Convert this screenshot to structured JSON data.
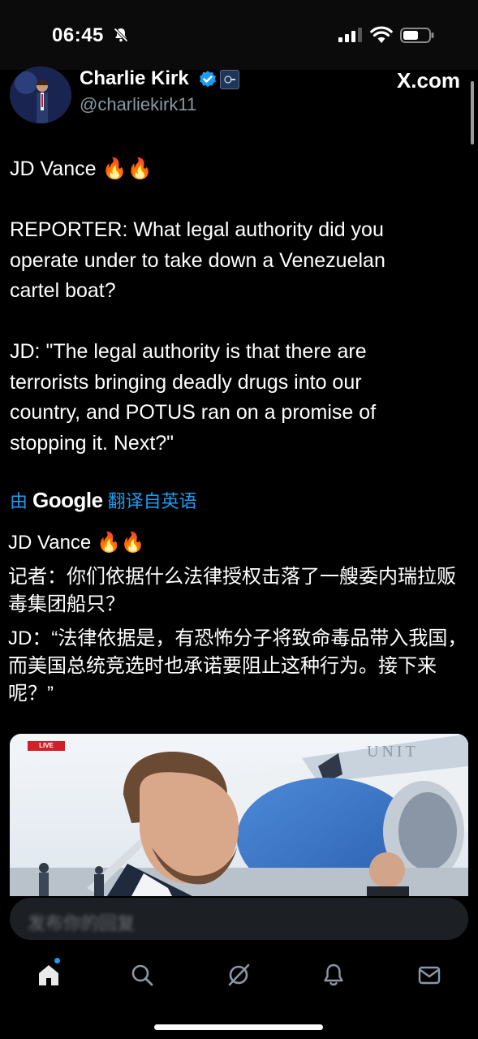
{
  "status_bar": {
    "time": "06:45"
  },
  "post": {
    "author_name": "Charlie Kirk",
    "author_handle": "@charliekirk11",
    "source": "X.com",
    "text_lines": [
      "JD Vance 🔥🔥",
      "",
      "REPORTER: What legal authority did you",
      "operate under to take down a Venezuelan",
      "cartel boat?",
      "",
      "JD: \"The legal authority is that there are",
      "terrorists bringing deadly drugs into our",
      "country, and POTUS ran on a promise of",
      "stopping it. Next?\""
    ],
    "translate": {
      "prefix": "由",
      "brand": "Google",
      "suffix": "翻译自英语"
    },
    "translated_paragraphs": [
      "JD Vance 🔥🔥",
      "记者：你们依据什么法律授权击落了一艘委内瑞拉贩毒集团船只？",
      "JD：“法律依据是，有恐怖分子将致命毒品带入我国，而美国总统竞选时也承诺要阻止这种行为。接下来呢？”"
    ],
    "video": {
      "badge": "LIVE"
    }
  },
  "composer": {
    "placeholder": "发布你的回复"
  },
  "tabs": [
    {
      "name": "home",
      "icon": "home-icon"
    },
    {
      "name": "search",
      "icon": "search-icon"
    },
    {
      "name": "grok",
      "icon": "grok-icon"
    },
    {
      "name": "notifications",
      "icon": "bell-icon"
    },
    {
      "name": "messages",
      "icon": "mail-icon"
    }
  ],
  "colors": {
    "accent": "#1d9bf0",
    "background": "#000000",
    "muted": "#8b98a5"
  }
}
